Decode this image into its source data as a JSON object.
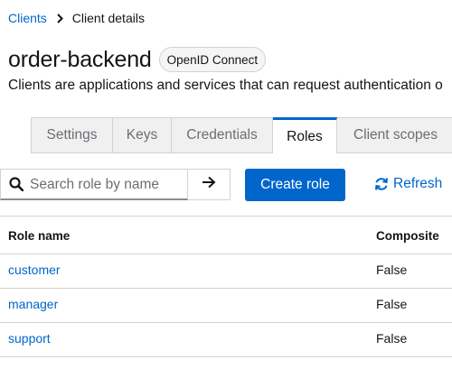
{
  "breadcrumb": {
    "parent": "Clients",
    "current": "Client details"
  },
  "header": {
    "title": "order-backend",
    "badge": "OpenID Connect",
    "description": "Clients are applications and services that can request authentication o"
  },
  "tabs": [
    {
      "label": "Settings"
    },
    {
      "label": "Keys"
    },
    {
      "label": "Credentials"
    },
    {
      "label": "Roles",
      "active": true
    },
    {
      "label": "Client scopes"
    }
  ],
  "toolbar": {
    "search_placeholder": "Search role by name",
    "create_label": "Create role",
    "refresh_label": "Refresh"
  },
  "table": {
    "headers": {
      "name": "Role name",
      "composite": "Composite"
    },
    "rows": [
      {
        "name": "customer",
        "composite": "False"
      },
      {
        "name": "manager",
        "composite": "False"
      },
      {
        "name": "support",
        "composite": "False"
      }
    ]
  },
  "colors": {
    "link": "#0066cc",
    "primary": "#0066cc",
    "border": "#d2d2d2"
  },
  "icons": {
    "breadcrumb_sep": "chevron-right-icon",
    "search": "search-icon",
    "go": "arrow-right-icon",
    "refresh": "refresh-icon"
  }
}
